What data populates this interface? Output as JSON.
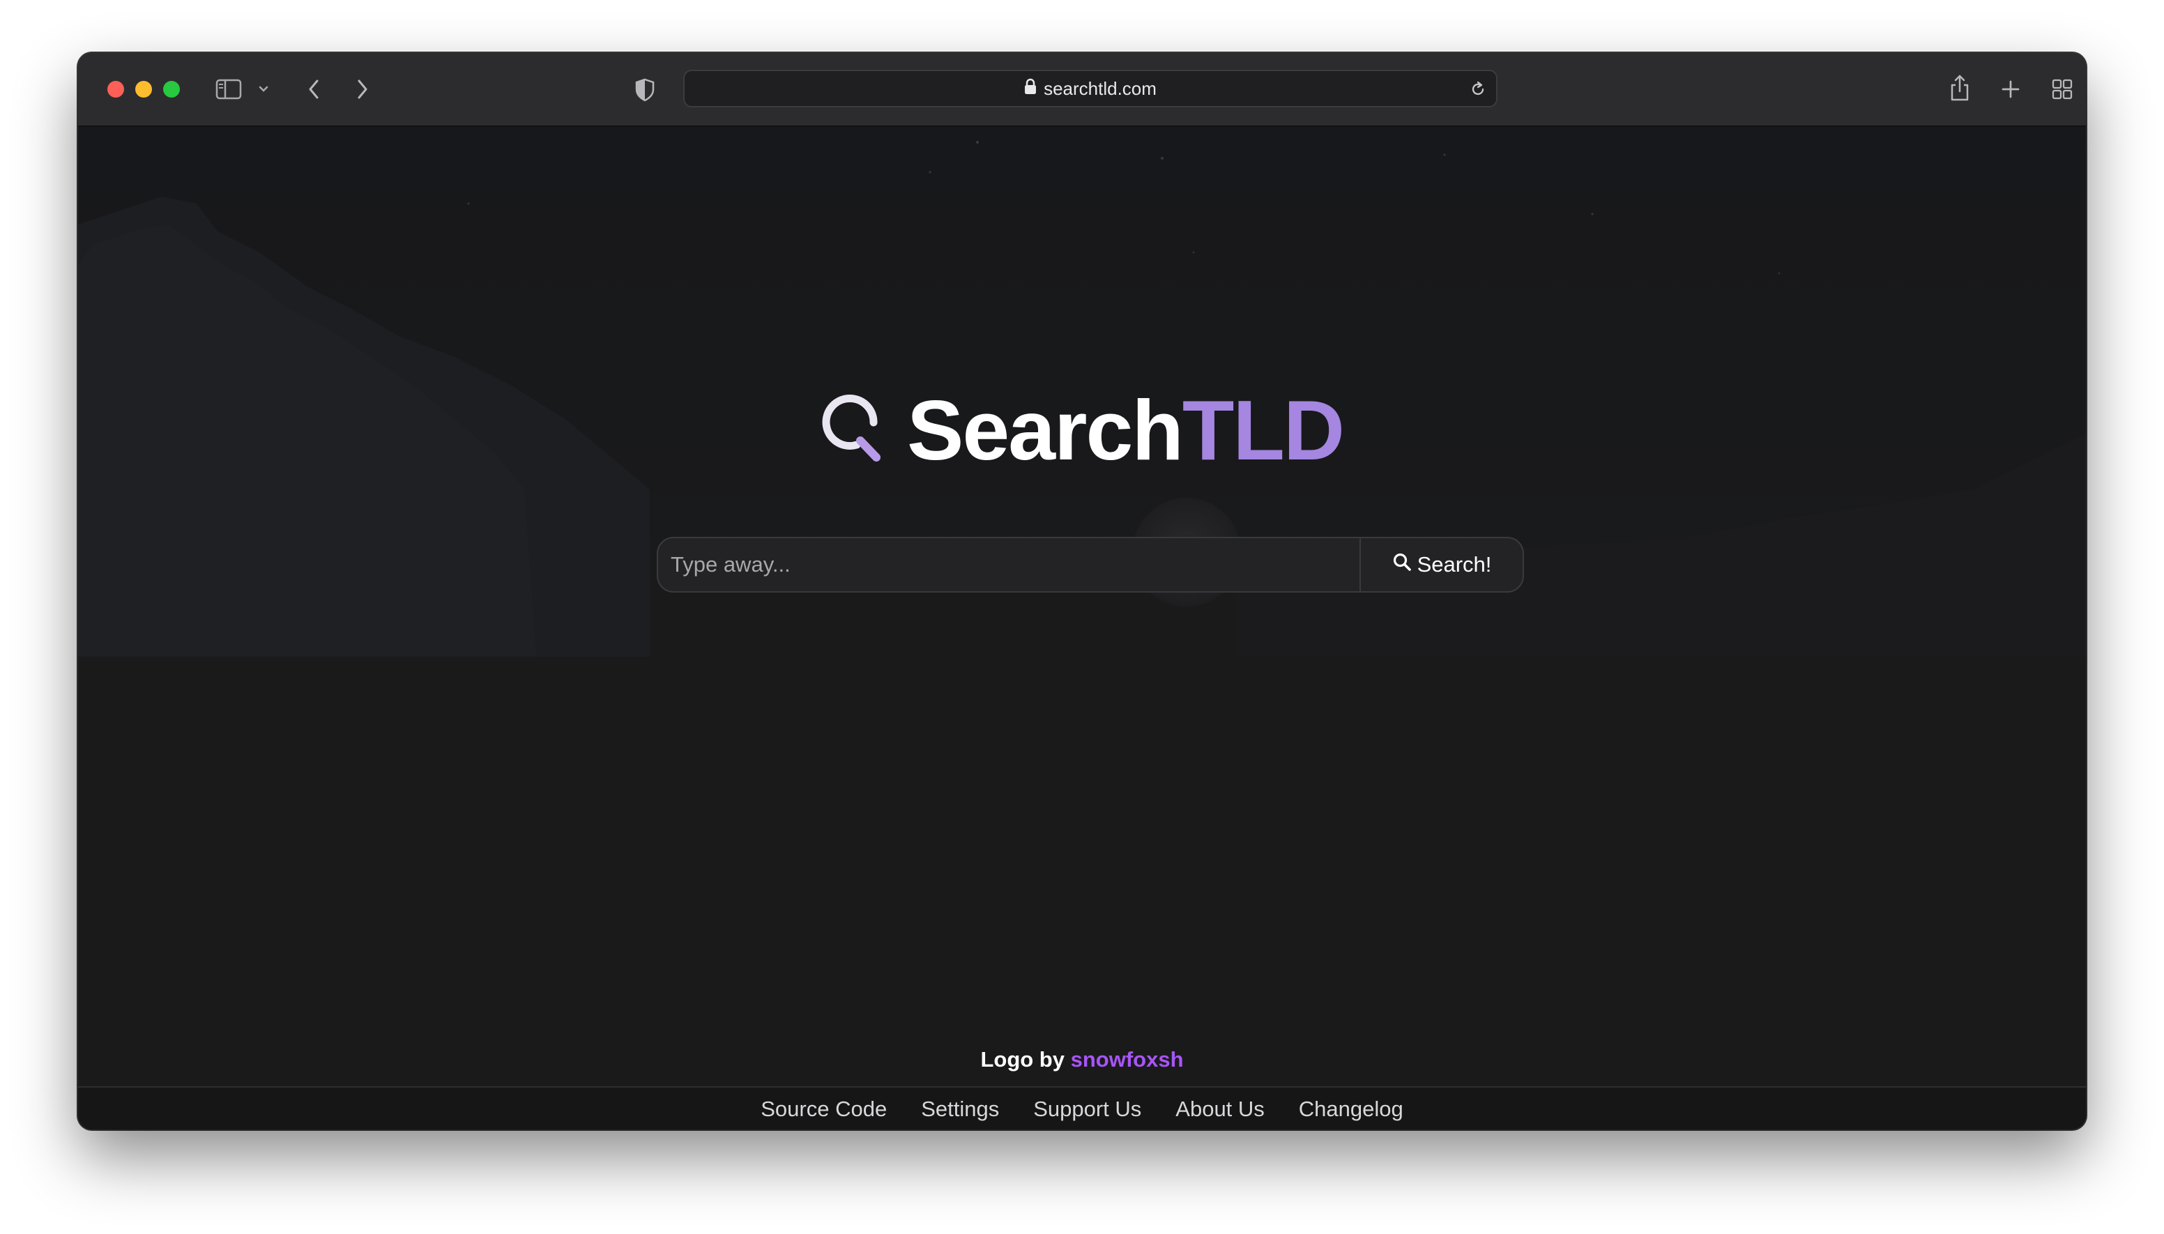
{
  "browser": {
    "url": "searchtld.com",
    "icons": {
      "sidebar": "sidebar-icon",
      "sidebar_menu": "chevron-down-icon",
      "back": "chevron-left-icon",
      "forward": "chevron-right-icon",
      "privacy": "shield-icon",
      "lock": "lock-icon",
      "reload": "reload-icon",
      "share": "share-icon",
      "new_tab": "plus-icon",
      "tab_overview": "grid-icon"
    }
  },
  "logo": {
    "title_main": "Search",
    "title_accent": "TLD",
    "accent_color": "#a586e0"
  },
  "search": {
    "placeholder": "Type away...",
    "value": "",
    "button_label": "Search!"
  },
  "credit": {
    "prefix": "Logo by",
    "author": "snowfoxsh",
    "author_color": "#a855f7"
  },
  "footer": {
    "links": [
      "Source Code",
      "Settings",
      "Support Us",
      "About Us",
      "Changelog"
    ]
  }
}
